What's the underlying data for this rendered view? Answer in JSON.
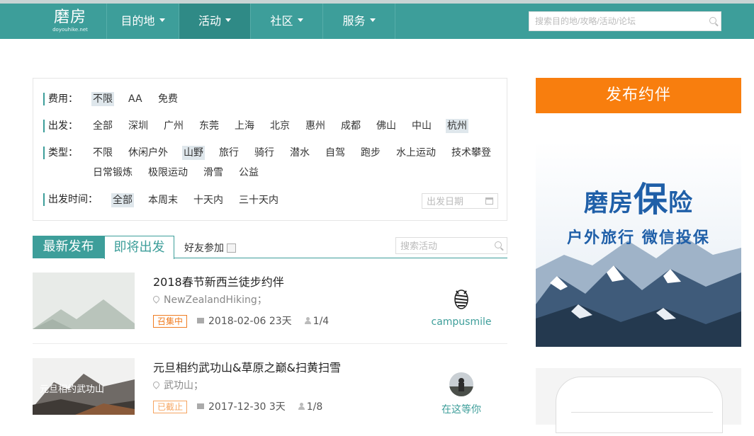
{
  "nav": {
    "logo_cn": "磨房",
    "logo_en": "doyouhike.net",
    "items": [
      {
        "label": "目的地",
        "active": false
      },
      {
        "label": "活动",
        "active": true
      },
      {
        "label": "社区",
        "active": false
      },
      {
        "label": "服务",
        "active": false
      }
    ],
    "search_placeholder": "搜索目的地/攻略/活动/论坛"
  },
  "filters": {
    "fee": {
      "label": "费用：",
      "options": [
        "不限",
        "AA",
        "免费"
      ],
      "selected": "不限"
    },
    "depart": {
      "label": "出发：",
      "options": [
        "全部",
        "深圳",
        "广州",
        "东莞",
        "上海",
        "北京",
        "惠州",
        "成都",
        "佛山",
        "中山",
        "杭州"
      ],
      "selected": "杭州"
    },
    "type": {
      "label": "类型：",
      "options": [
        "不限",
        "休闲户外",
        "山野",
        "旅行",
        "骑行",
        "潜水",
        "自驾",
        "跑步",
        "水上运动",
        "技术攀登",
        "日常锻炼",
        "极限运动",
        "滑雪",
        "公益"
      ],
      "selected": "山野"
    },
    "time": {
      "label": "出发时间：",
      "options": [
        "全部",
        "本周末",
        "十天内",
        "三十天内"
      ],
      "selected": "全部",
      "date_placeholder": "出发日期"
    }
  },
  "tabs": {
    "latest": "最新发布",
    "upcoming": "即将出发",
    "friends_label": "好友参加",
    "search_placeholder": "搜索活动"
  },
  "activities": [
    {
      "title": "2018春节新西兰徒步约伴",
      "location": "NewZealandHiking；",
      "status": "召集中",
      "date": "2018-02-06",
      "duration": "23天",
      "members": "1/4",
      "user": "campusmile"
    },
    {
      "title": "元旦相约武功山&草原之巅&扫黄扫雪",
      "location": "武功山；",
      "status": "已截止",
      "date": "2017-12-30",
      "duration": "3天",
      "members": "1/8",
      "user": "在这等你",
      "thumb_text": "元旦相约武功山"
    }
  ],
  "sidebar": {
    "post_button": "发布约伴",
    "ad_title_left": "磨房",
    "ad_title_big": "保",
    "ad_title_right": "险",
    "ad_subtitle": "户外旅行 微信投保"
  },
  "colors": {
    "nav": "#3d9e9a",
    "accent_orange": "#f87e0e",
    "ad_blue": "#1f5fa8"
  }
}
